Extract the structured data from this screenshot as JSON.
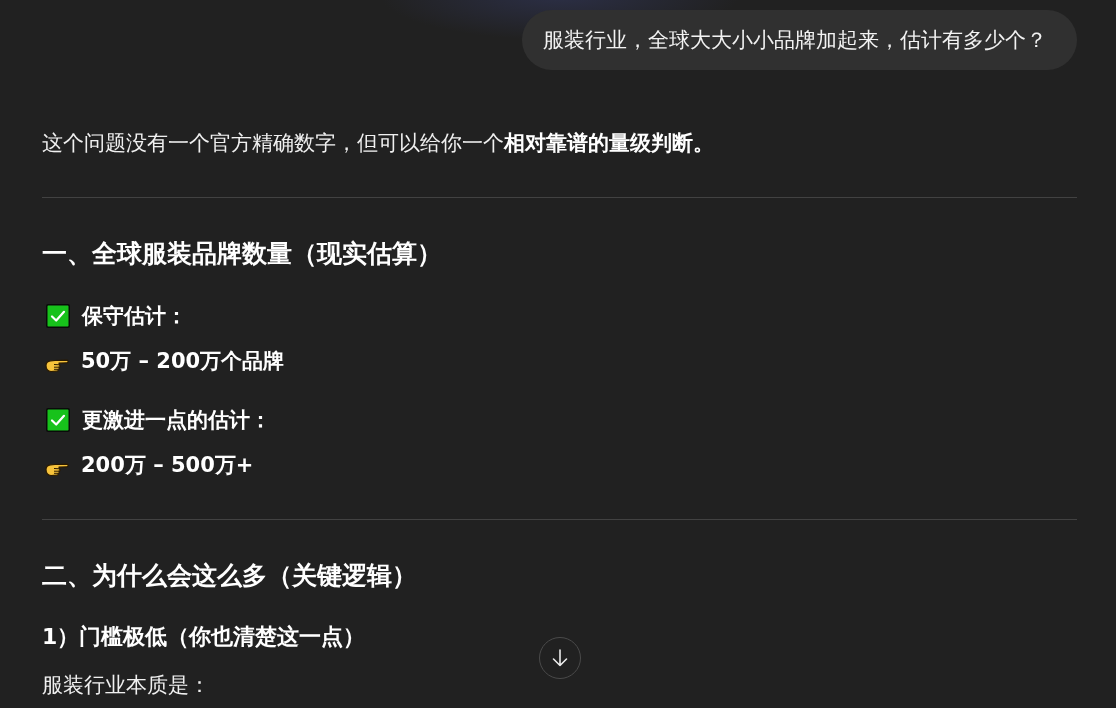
{
  "user_message": {
    "text": "服装行业，全球大大小小品牌加起来，估计有多少个？"
  },
  "response": {
    "blocks": [
      {
        "kind": "paragraph",
        "text": "这个问题没有一个官方精确数字，但可以给你一个**相对靠谱的量级判断。**"
      },
      {
        "kind": "divider"
      },
      {
        "kind": "heading",
        "text": "一、全球服装品牌数量（现实估算）"
      },
      {
        "kind": "check_item",
        "text": "保守估计："
      },
      {
        "kind": "pointer_item",
        "text": "50万 – 200万个品牌"
      },
      {
        "kind": "check_item",
        "text": "更激进一点的估计："
      },
      {
        "kind": "pointer_item",
        "text": "200万 – 500万+"
      },
      {
        "kind": "divider"
      },
      {
        "kind": "heading",
        "text": "二、为什么会这么多（关键逻辑）"
      },
      {
        "kind": "subheading",
        "text": "1）门槛极低（你也清楚这一点）"
      },
      {
        "kind": "paragraph",
        "text": "服装行业本质是："
      }
    ]
  }
}
